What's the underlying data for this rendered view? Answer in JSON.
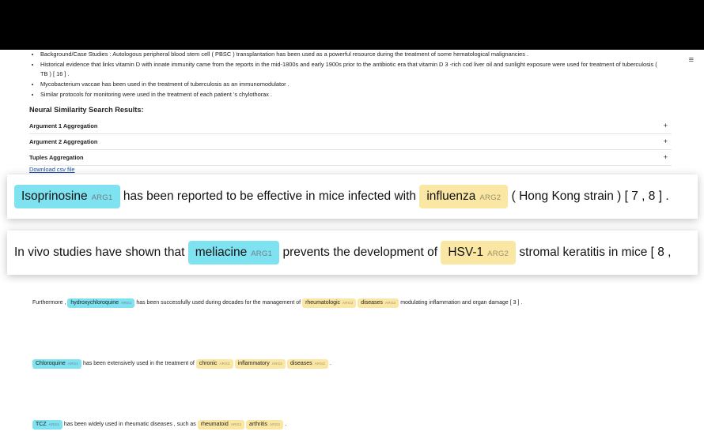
{
  "bullets": [
    "Background/Case Studies : Autologous peripheral blood stem cell ( PBSC ) transplantation has been used as a powerful resource during the treatment of some hematological malignancies .",
    "Historical evidence that links vitamin D with innate immunity came from the reports in the mid-1800s and early 1900s prior to the antibiotic era that vitamin D 3 -rich cod liver oil and sunlight exposure were used for treatment of tuberculosis ( TB ) [ 16 ] .",
    "Mycobacterium vaccae has been used in the treatment of tuberculosis as an immunomodulator .",
    "Similar protocols for monitoring were used in the treatment of each patient 's chylothorax ."
  ],
  "menu_icon": "≡",
  "section_title": "Neural Similarity Search Results:",
  "accordion": [
    {
      "label": "Argument 1 Aggregation",
      "icon": "+"
    },
    {
      "label": "Argument 2 Aggregation",
      "icon": "+"
    },
    {
      "label": "Tuples Aggregation",
      "icon": "+"
    }
  ],
  "download_label": "Download csv file",
  "tags": {
    "arg1": "ARG1",
    "arg2": "ARG2"
  },
  "sentences": [
    {
      "parts": [
        {
          "type": "arg1",
          "text": "Isoprinosine"
        },
        {
          "type": "text",
          "text": " has been reported to be effective in mice infected with "
        },
        {
          "type": "arg2",
          "text": "influenza"
        },
        {
          "type": "text",
          "text": " ( Hong Kong strain ) [ 7 , 8 ] ."
        }
      ]
    },
    {
      "parts": [
        {
          "type": "text",
          "text": "In vivo studies have shown that "
        },
        {
          "type": "arg1",
          "text": "meliacine"
        },
        {
          "type": "text",
          "text": " prevents the development of "
        },
        {
          "type": "arg2",
          "text": "HSV-1"
        },
        {
          "type": "text",
          "text": " stromal keratitis in mice [ 8 ,"
        }
      ]
    },
    {
      "parts": [
        {
          "type": "text",
          "text": "Furthermore , "
        },
        {
          "type": "arg1",
          "text": "hydroxychloroquine"
        },
        {
          "type": "text",
          "text": " has been successfully used during decades for the management of "
        },
        {
          "type": "arg2",
          "text": "rheumatologic"
        },
        {
          "type": "arg2",
          "text": "diseases"
        },
        {
          "type": "text",
          "text": " modulating inflammation and organ damage [ 3 ] ."
        }
      ]
    },
    {
      "parts": [
        {
          "type": "arg1",
          "text": "Chloroquine"
        },
        {
          "type": "text",
          "text": " has been extensively used in the treatment of "
        },
        {
          "type": "arg2",
          "text": "chronic"
        },
        {
          "type": "arg2",
          "text": "inflammatory"
        },
        {
          "type": "arg2",
          "text": "diseases"
        },
        {
          "type": "text",
          "text": " ."
        }
      ]
    },
    {
      "parts": [
        {
          "type": "arg1",
          "text": "TCZ"
        },
        {
          "type": "text",
          "text": " has been widely used in rheumatic diseases , such as "
        },
        {
          "type": "arg2",
          "text": "rheumatoid"
        },
        {
          "type": "arg2",
          "text": "arthritis"
        },
        {
          "type": "text",
          "text": " ."
        }
      ]
    }
  ]
}
